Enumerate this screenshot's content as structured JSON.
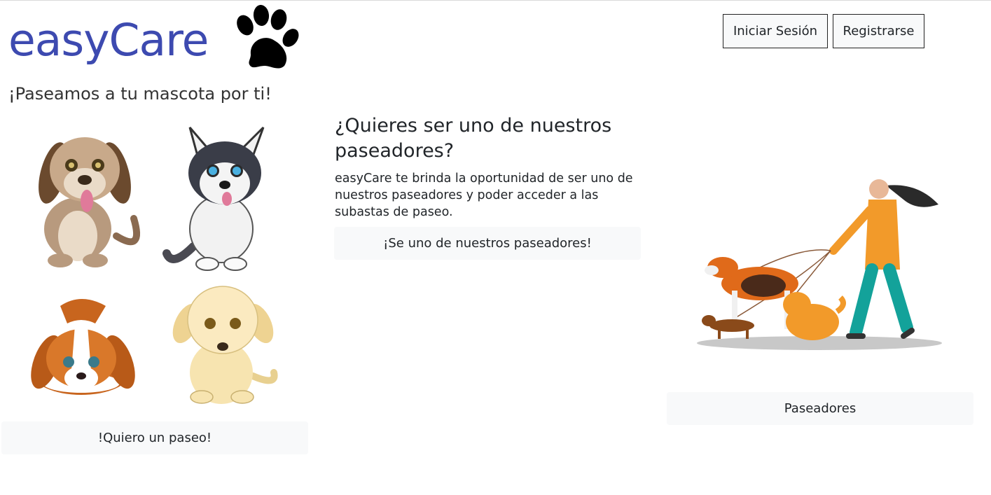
{
  "brand": {
    "name": "easyCare",
    "tagline": "¡Paseamos a tu mascota por ti!",
    "color": "#3d4ab0"
  },
  "auth": {
    "login_label": "Iniciar Sesión",
    "register_label": "Registrarse"
  },
  "pets": {
    "request_walk_label": "!Quiero un paseo!"
  },
  "walker_offer": {
    "title": "¿Quieres ser uno de nuestros paseadores?",
    "description": "easyCare te brinda la oportunidad de ser uno de nuestros paseadores y poder acceder a las subastas de paseo.",
    "join_label": "¡Se uno de nuestros paseadores!"
  },
  "walkers": {
    "button_label": "Paseadores"
  }
}
